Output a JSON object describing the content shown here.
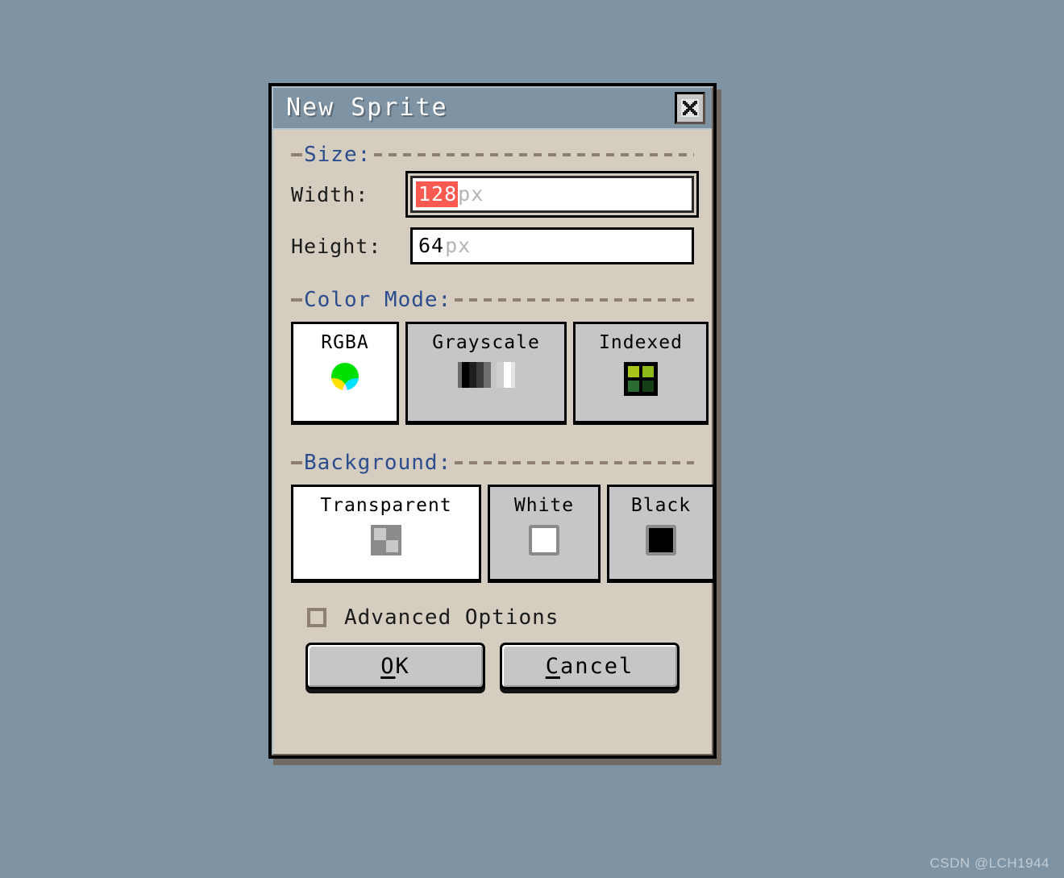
{
  "desktop": {
    "background_color": "#7e93a4",
    "watermark": "CSDN @LCH1944"
  },
  "dialog": {
    "title": "New Sprite",
    "body_color": "#d4cdc0",
    "titlebar_color": "#7e93a4",
    "close_icon": "close-x-icon",
    "sections": {
      "size": {
        "label": "Size:",
        "label_color": "#2b4d8e",
        "fields": [
          {
            "label": "Width:",
            "value": "128",
            "suffix": "px",
            "selected": true,
            "focused": true,
            "selection_color": "#fa5a50"
          },
          {
            "label": "Height:",
            "value": "64",
            "suffix": "px",
            "selected": false,
            "focused": false
          }
        ]
      },
      "color_mode": {
        "label": "Color Mode:",
        "selected": "RGBA",
        "options": [
          {
            "label": "RGBA",
            "icon": "rgb-venn-icon",
            "selected": true
          },
          {
            "label": "Grayscale",
            "icon": "grayscale-ramp-icon",
            "selected": false
          },
          {
            "label": "Indexed",
            "icon": "palette-grid-icon",
            "selected": false
          }
        ]
      },
      "background": {
        "label": "Background:",
        "selected": "Transparent",
        "options": [
          {
            "label": "Transparent",
            "icon": "checkerboard-icon",
            "selected": true
          },
          {
            "label": "White",
            "icon": "white-swatch-icon",
            "selected": false
          },
          {
            "label": "Black",
            "icon": "black-swatch-icon",
            "selected": false
          }
        ]
      }
    },
    "advanced_options": {
      "label": "Advanced Options",
      "checked": false
    },
    "buttons": {
      "ok": {
        "mnemonic": "O",
        "rest": "K"
      },
      "cancel": {
        "mnemonic": "C",
        "rest": "ancel"
      }
    }
  },
  "chart_data": null
}
